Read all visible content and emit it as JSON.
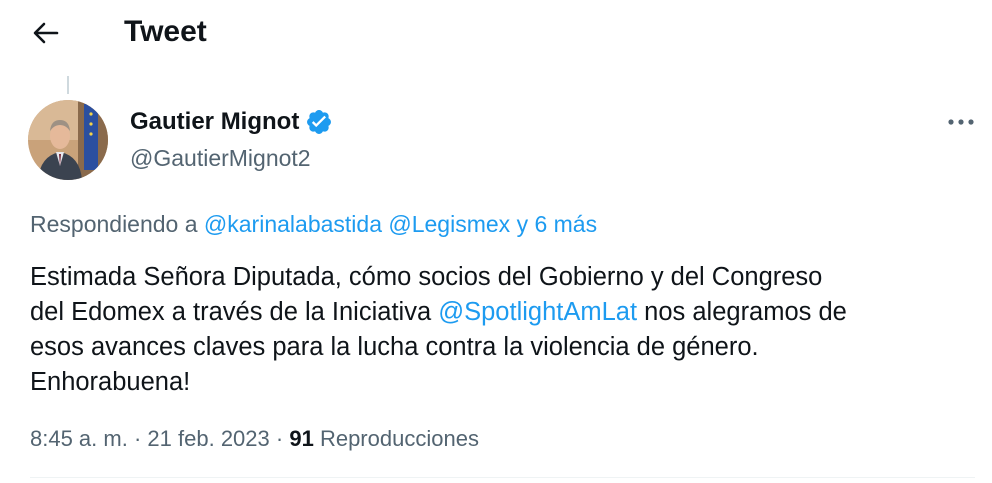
{
  "header": {
    "title": "Tweet"
  },
  "author": {
    "display_name": "Gautier Mignot",
    "handle": "@GautierMignot2"
  },
  "reply_context": {
    "prefix": "Respondiendo a",
    "mention_1": "@karinalabastida",
    "mention_2": "@Legismex",
    "more": "y 6 más"
  },
  "tweet": {
    "line_1": "Estimada Señora Diputada, cómo socios del Gobierno y del Congreso",
    "line_2_before": "del Edomex a través de la Iniciativa",
    "line_2_mention": "@SpotlightAmLat",
    "line_2_after": "nos alegramos de",
    "line_3": "esos avances claves para la lucha contra la violencia de género.",
    "line_4": "Enhorabuena!"
  },
  "meta": {
    "time": "8:45 a. m.",
    "date": "21 feb. 2023",
    "views_count": "91",
    "views_label": "Reproducciones"
  },
  "colors": {
    "accent": "#1d9bf0",
    "text_primary": "#0f1419",
    "text_secondary": "#536471",
    "verified_badge": "#1d9bf0"
  },
  "icons": {
    "back": "arrow-left-icon",
    "verified": "verified-badge-icon",
    "more": "more-dots-icon"
  }
}
